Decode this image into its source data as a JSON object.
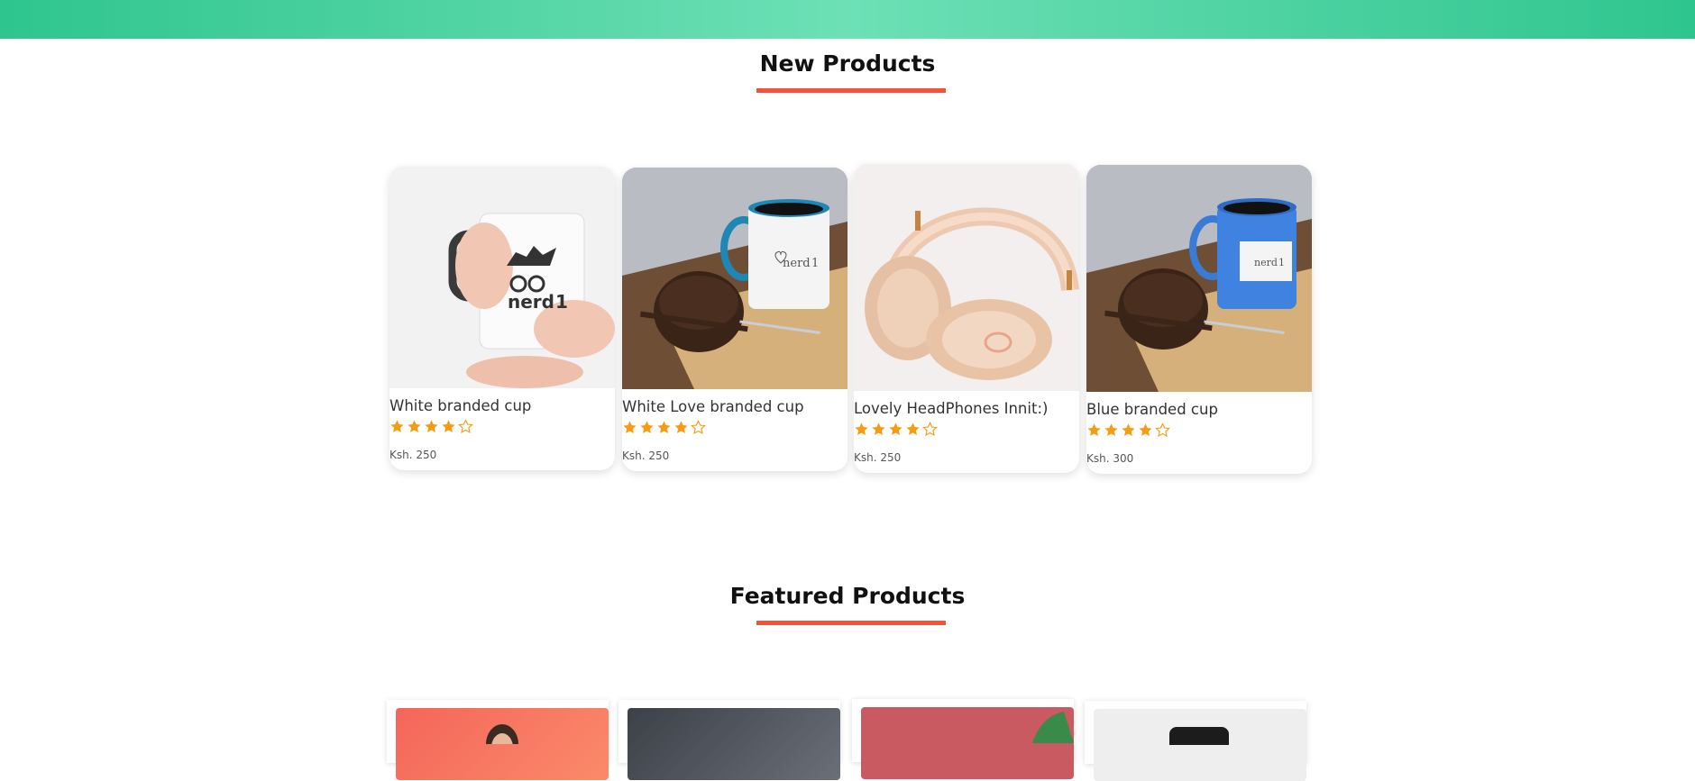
{
  "new_products": {
    "title": "New Products",
    "items": [
      {
        "name": "White branded cup",
        "price": "Ksh. 250",
        "rating": 4,
        "max_rating": 5,
        "image": "nerd-mug-in-hands-image"
      },
      {
        "name": "White Love branded cup",
        "price": "Ksh. 250",
        "rating": 4,
        "max_rating": 5,
        "image": "white-mug-with-muffin-image"
      },
      {
        "name": "Lovely HeadPhones Innit:)",
        "price": "Ksh. 250",
        "rating": 4,
        "max_rating": 5,
        "image": "peach-headphones-image"
      },
      {
        "name": "Blue branded cup",
        "price": "Ksh. 300",
        "rating": 4,
        "max_rating": 5,
        "image": "blue-mug-with-muffin-image"
      }
    ]
  },
  "featured_products": {
    "title": "Featured Products"
  },
  "mug_logo": {
    "nerd_text": "nerd",
    "nerd_number": "1",
    "love_text": "nerd",
    "love_number": "1"
  },
  "colors": {
    "header_gradient_start": "#2fc58f",
    "header_gradient_mid": "#6de0b6",
    "accent_underline": "#f4533b",
    "star": "#f59c12"
  }
}
